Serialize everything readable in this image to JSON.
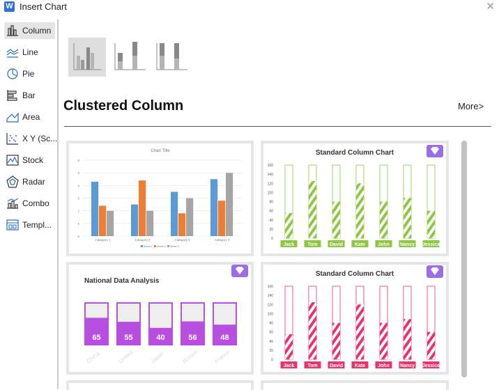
{
  "window": {
    "title": "Insert Chart",
    "logo": "W",
    "close": "✕"
  },
  "sidebar": {
    "items": [
      {
        "label": "Column",
        "icon": "column-chart-icon"
      },
      {
        "label": "Line",
        "icon": "line-chart-icon"
      },
      {
        "label": "Pie",
        "icon": "pie-chart-icon"
      },
      {
        "label": "Bar",
        "icon": "bar-chart-icon"
      },
      {
        "label": "Area",
        "icon": "area-chart-icon"
      },
      {
        "label": "X Y (Sc...",
        "icon": "scatter-chart-icon"
      },
      {
        "label": "Stock",
        "icon": "stock-chart-icon"
      },
      {
        "label": "Radar",
        "icon": "radar-chart-icon"
      },
      {
        "label": "Combo",
        "icon": "combo-chart-icon"
      },
      {
        "label": "Templ...",
        "icon": "template-icon"
      }
    ]
  },
  "main": {
    "heading": "Clustered Column",
    "more_label": "More>",
    "subtypes": [
      "clustered-column",
      "stacked-column",
      "100-percent-stacked-column"
    ]
  },
  "colors": {
    "series1": "#5b9bd5",
    "series2": "#ed7d31",
    "series3": "#a5a5a5",
    "green": "#8dc63f",
    "pink": "#e8336d",
    "purple": "#b84fe0",
    "premium": "#9b6ee8"
  },
  "chart_data": [
    {
      "type": "bar",
      "title": "Chart Title",
      "categories": [
        "Category 1",
        "Category 2",
        "Category 3",
        "Category 4"
      ],
      "series": [
        {
          "name": "Series 1",
          "values": [
            4.3,
            2.5,
            3.5,
            4.5
          ]
        },
        {
          "name": "Series 2",
          "values": [
            2.4,
            4.4,
            1.8,
            2.8
          ]
        },
        {
          "name": "Series 3",
          "values": [
            2,
            2,
            3,
            5
          ]
        }
      ],
      "ylim": [
        0,
        6
      ],
      "yticks": [
        "0",
        "1",
        "2",
        "3",
        "4",
        "5",
        "6"
      ],
      "legend": "bottom",
      "grid": true
    },
    {
      "type": "bar",
      "title": "Standard Column Chart",
      "categories": [
        "Jack",
        "Tom",
        "David",
        "Kate",
        "John",
        "Nancy",
        "Jessica"
      ],
      "values": [
        55,
        125,
        80,
        120,
        80,
        88,
        60
      ],
      "ylim": [
        0,
        160
      ],
      "yticks": [
        "0",
        "20",
        "40",
        "60",
        "80",
        "100",
        "120",
        "140",
        "160"
      ],
      "color": "#8dc63f"
    },
    {
      "type": "bar",
      "title": "National Data Analysis",
      "categories": [
        "China",
        "United...",
        "Japan",
        "Russia",
        "France"
      ],
      "values": [
        65,
        55,
        40,
        56,
        48
      ],
      "ylim": [
        0,
        100
      ],
      "color": "#b84fe0"
    },
    {
      "type": "bar",
      "title": "Standard Column Chart",
      "categories": [
        "Jack",
        "Tom",
        "David",
        "Kate",
        "John",
        "Nancy",
        "Jessica"
      ],
      "values": [
        55,
        125,
        80,
        120,
        80,
        88,
        60
      ],
      "ylim": [
        0,
        160
      ],
      "yticks": [
        "0",
        "20",
        "40",
        "60",
        "80",
        "100",
        "120",
        "140",
        "160"
      ],
      "color": "#e8336d"
    }
  ]
}
